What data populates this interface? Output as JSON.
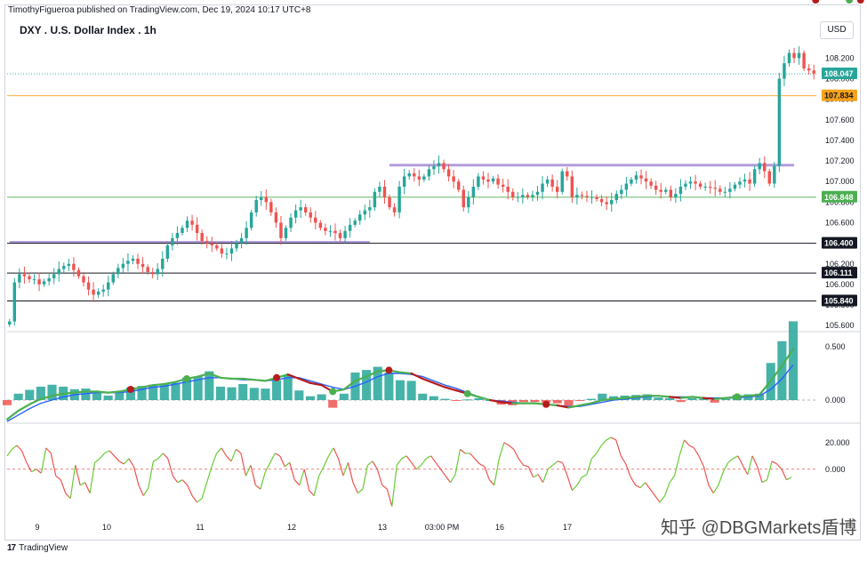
{
  "publisher_line": "TimothyFigueroa published on TradingView.com, Dec 19, 2024 10:17 UTC+8",
  "title": "DXY . U.S. Dollar Index . 1h",
  "currency": "USD",
  "footer": {
    "logo": "17",
    "brand": "TradingView"
  },
  "watermark": "知乎 @DBGMarkets盾博",
  "colors": {
    "up": "#26a69a",
    "down": "#ef5350",
    "orange": "#f7a21b",
    "green_line": "#4caf50",
    "purple": "#b39ddb",
    "blue": "#2962ff",
    "dark_red": "#b71c1c",
    "osc_green": "#66cc33",
    "osc_red": "#ef5350"
  },
  "chart_data": [
    {
      "type": "candlestick",
      "title": "DXY . U.S. Dollar Index . 1h",
      "ylim": [
        105.55,
        108.35
      ],
      "y_ticks": [
        "105.600",
        "105.800",
        "106.000",
        "106.200",
        "106.400",
        "106.600",
        "106.800",
        "107.000",
        "107.200",
        "107.400",
        "107.600",
        "107.800",
        "108.000",
        "108.200"
      ],
      "x_ticks": [
        "9",
        "10",
        "11",
        "12",
        "13",
        "03:00 PM",
        "16",
        "17"
      ],
      "closes": [
        105.64,
        106.02,
        106.1,
        106.08,
        106.05,
        106.05,
        106.0,
        106.03,
        106.06,
        106.1,
        106.15,
        106.18,
        106.2,
        106.14,
        106.08,
        106.02,
        105.95,
        105.9,
        105.93,
        105.95,
        106.02,
        106.1,
        106.16,
        106.2,
        106.23,
        106.25,
        106.2,
        106.17,
        106.12,
        106.1,
        106.15,
        106.25,
        106.38,
        106.45,
        106.5,
        106.55,
        106.62,
        106.58,
        106.5,
        106.42,
        106.4,
        106.38,
        106.35,
        106.3,
        106.3,
        106.35,
        106.4,
        106.45,
        106.55,
        106.7,
        106.82,
        106.85,
        106.8,
        106.7,
        106.6,
        106.45,
        106.55,
        106.65,
        106.72,
        106.75,
        106.7,
        106.65,
        106.6,
        106.55,
        106.52,
        106.52,
        106.5,
        106.45,
        106.52,
        106.58,
        106.62,
        106.68,
        106.72,
        106.75,
        106.9,
        106.95,
        106.85,
        106.75,
        106.7,
        106.95,
        107.05,
        107.08,
        107.05,
        107.02,
        107.05,
        107.12,
        107.15,
        107.18,
        107.12,
        107.05,
        107.0,
        106.92,
        106.75,
        106.85,
        106.95,
        107.05,
        107.02,
        107.0,
        107.03,
        106.97,
        106.95,
        106.9,
        106.85,
        106.85,
        106.87,
        106.85,
        106.87,
        106.9,
        106.98,
        107.02,
        106.95,
        106.9,
        107.1,
        107.05,
        106.85,
        106.87,
        106.86,
        106.85,
        106.85,
        106.83,
        106.8,
        106.78,
        106.82,
        106.88,
        106.92,
        106.98,
        107.02,
        107.06,
        107.03,
        107.0,
        106.96,
        106.92,
        106.9,
        106.92,
        106.85,
        106.88,
        106.95,
        106.98,
        107.0,
        106.98,
        106.95,
        106.95,
        106.94,
        106.93,
        106.9,
        106.9,
        106.93,
        106.97,
        107.0,
        107.02,
        106.98,
        107.12,
        107.18,
        107.1,
        106.98,
        107.15,
        108.0,
        108.15,
        108.25,
        108.2,
        108.25,
        108.1,
        108.08,
        108.05
      ],
      "last_price": "108.047",
      "price_lines": [
        {
          "value": 107.834,
          "label": "107.834",
          "color": "#f7a21b"
        },
        {
          "value": 106.848,
          "label": "106.848",
          "color": "#4caf50"
        },
        {
          "value": 106.4,
          "label": "106.400",
          "color": "#131722"
        },
        {
          "value": 106.111,
          "label": "106.111",
          "color": "#131722"
        },
        {
          "value": 105.84,
          "label": "105.840",
          "color": "#131722"
        }
      ],
      "resistance_zones": [
        {
          "value": 107.16,
          "from_bar": 77,
          "to_bar": 159
        },
        {
          "value": 106.41,
          "from_bar": 0,
          "to_bar": 73
        }
      ]
    },
    {
      "type": "histogram_with_lines",
      "ylim": [
        -0.2,
        0.6
      ],
      "y_ticks": [
        "0.500",
        "0.000"
      ],
      "fast_line": [
        -0.18,
        -0.1,
        -0.04,
        0.01,
        0.04,
        0.06,
        0.07,
        0.08,
        0.08,
        0.07,
        0.08,
        0.1,
        0.12,
        0.14,
        0.15,
        0.17,
        0.2,
        0.22,
        0.25,
        0.21,
        0.2,
        0.2,
        0.19,
        0.18,
        0.21,
        0.24,
        0.2,
        0.16,
        0.14,
        0.08,
        0.1,
        0.18,
        0.22,
        0.27,
        0.28,
        0.26,
        0.25,
        0.2,
        0.16,
        0.12,
        0.09,
        0.06,
        0.03,
        0.0,
        -0.02,
        -0.03,
        -0.03,
        -0.03,
        -0.04,
        -0.05,
        -0.07,
        -0.05,
        -0.03,
        0.0,
        0.01,
        0.02,
        0.03,
        0.04,
        0.04,
        0.03,
        0.02,
        0.03,
        0.02,
        0.01,
        0.02,
        0.03,
        0.04,
        0.05,
        0.18,
        0.32,
        0.48
      ],
      "slow_line": [
        -0.2,
        -0.14,
        -0.08,
        -0.03,
        0.0,
        0.03,
        0.05,
        0.06,
        0.07,
        0.07,
        0.07,
        0.08,
        0.1,
        0.12,
        0.13,
        0.15,
        0.17,
        0.19,
        0.21,
        0.21,
        0.2,
        0.19,
        0.19,
        0.18,
        0.19,
        0.21,
        0.21,
        0.18,
        0.15,
        0.12,
        0.1,
        0.13,
        0.17,
        0.22,
        0.25,
        0.25,
        0.24,
        0.22,
        0.18,
        0.14,
        0.11,
        0.07,
        0.03,
        0.0,
        -0.01,
        -0.02,
        -0.03,
        -0.03,
        -0.04,
        -0.05,
        -0.06,
        -0.06,
        -0.04,
        -0.02,
        0.0,
        0.01,
        0.02,
        0.03,
        0.04,
        0.03,
        0.03,
        0.03,
        0.02,
        0.02,
        0.02,
        0.02,
        0.03,
        0.04,
        0.1,
        0.2,
        0.33
      ],
      "cross_markers": [
        {
          "index": 11,
          "type": "bearish"
        },
        {
          "index": 16,
          "type": "bullish"
        },
        {
          "index": 24,
          "type": "bearish"
        },
        {
          "index": 29,
          "type": "bullish"
        },
        {
          "index": 34,
          "type": "bearish"
        },
        {
          "index": 41,
          "type": "bullish"
        },
        {
          "index": 48,
          "type": "bearish"
        },
        {
          "index": 65,
          "type": "bullish"
        },
        {
          "index": 72,
          "type": "bearish"
        },
        {
          "index": 75,
          "type": "bullish"
        },
        {
          "index": 76,
          "type": "bearish"
        },
        {
          "index": 77,
          "type": "bullish"
        }
      ]
    },
    {
      "type": "line",
      "ylim": [
        -35,
        32
      ],
      "y_ticks": [
        "20.000",
        "0.000"
      ],
      "zero_line": 0,
      "values": [
        10,
        15,
        18,
        14,
        5,
        -2,
        0,
        -3,
        16,
        12,
        -5,
        -8,
        -18,
        -22,
        3,
        -12,
        -10,
        -18,
        5,
        8,
        12,
        14,
        10,
        6,
        4,
        8,
        2,
        -12,
        -20,
        -14,
        6,
        8,
        12,
        8,
        -5,
        -10,
        -8,
        -12,
        -20,
        -25,
        -22,
        -10,
        2,
        12,
        16,
        10,
        6,
        15,
        12,
        -5,
        3,
        -12,
        -15,
        -2,
        5,
        12,
        10,
        2,
        5,
        -8,
        -12,
        0,
        -16,
        -20,
        -5,
        2,
        10,
        16,
        8,
        -5,
        5,
        -10,
        -18,
        -15,
        3,
        6,
        0,
        -12,
        -15,
        -28,
        3,
        8,
        10,
        5,
        0,
        3,
        8,
        10,
        5,
        0,
        -5,
        -10,
        -4,
        15,
        12,
        12,
        8,
        4,
        2,
        -8,
        -12,
        8,
        20,
        18,
        15,
        8,
        3,
        2,
        -6,
        -4,
        -10,
        0,
        3,
        6,
        5,
        -5,
        -16,
        -12,
        -6,
        -4,
        8,
        12,
        18,
        22,
        24,
        22,
        10,
        4,
        -6,
        -12,
        -14,
        -10,
        -15,
        -20,
        -25,
        -20,
        -10,
        -5,
        10,
        22,
        18,
        16,
        10,
        2,
        -12,
        -18,
        -12,
        -2,
        5,
        8,
        10,
        3,
        -4,
        10,
        2,
        -10,
        -8,
        6,
        4,
        0,
        -8,
        -6
      ]
    }
  ]
}
